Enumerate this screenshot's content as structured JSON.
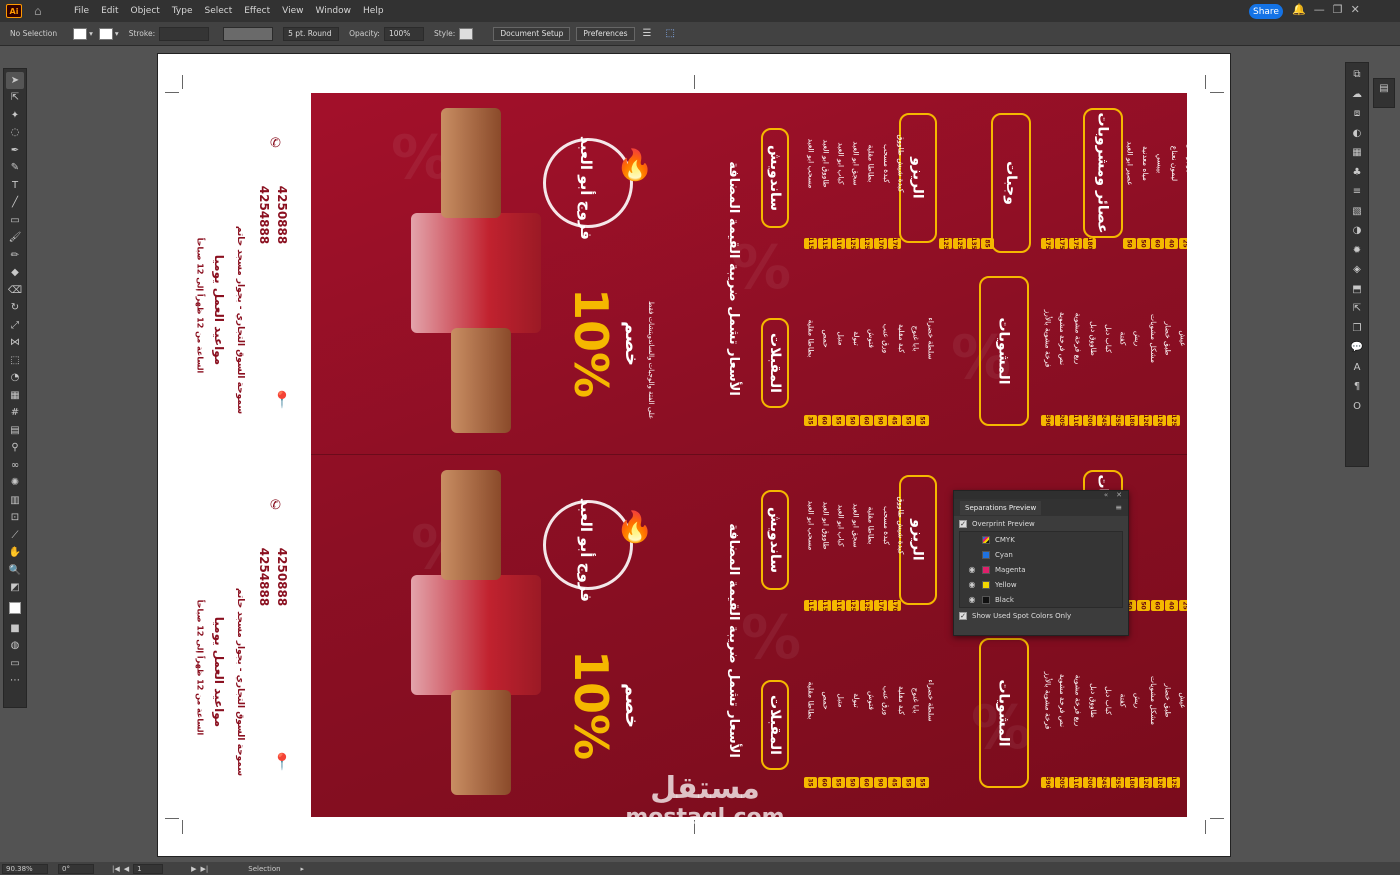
{
  "app": {
    "logo": "Ai"
  },
  "menubar": {
    "items": [
      "File",
      "Edit",
      "Object",
      "Type",
      "Select",
      "Effect",
      "View",
      "Window",
      "Help"
    ],
    "share_label": "Share"
  },
  "control_bar": {
    "selection_label": "No Selection",
    "stroke_label": "Stroke:",
    "brush_value": "5 pt. Round",
    "opacity_label": "Opacity:",
    "opacity_value": "100%",
    "style_label": "Style:",
    "document_setup_label": "Document Setup",
    "preferences_label": "Preferences"
  },
  "separations_panel": {
    "title": "Separations Preview",
    "overprint_label": "Overprint Preview",
    "inks": [
      {
        "name": "CMYK",
        "color": "#ffffff"
      },
      {
        "name": "Cyan",
        "color": "#1f72e0"
      },
      {
        "name": "Magenta",
        "color": "#e0206b"
      },
      {
        "name": "Yellow",
        "color": "#f2d600"
      },
      {
        "name": "Black",
        "color": "#111111"
      }
    ],
    "spot_label": "Show Used Spot Colors Only"
  },
  "status_bar": {
    "zoom": "90.38%",
    "rotation": "0°",
    "artboard": "1",
    "tool": "Selection"
  },
  "flyer": {
    "discount": "10%",
    "discount_word": "خصم",
    "discount_note": "على الفتة والوجبات والساندويتشات فقط",
    "brand": "فروج أبو العبد",
    "tax_note": "الأسعار تشمل ضريبة القيمة المضافة",
    "phone1": "4250888",
    "phone2": "4254888",
    "address": "سموحة السوق التجاري - بجوار مسجد حاتم",
    "hours_title": "مواعيد العمل يوميا",
    "hours": "الساعة من 12 ظهراً إلى 12 صباحاً",
    "categories": [
      "ساندويش",
      "المقبلات",
      "الريزو",
      "المشويات",
      "وجبات",
      "عصائر ومشروبات"
    ],
    "sandwiches": [
      "مسحب ابو العبد",
      "طاووق ابو العبد",
      "كباب ابو العبد",
      "سجق ابو العبد",
      "بطاطا مقلية",
      "كبدة مسحب",
      "كبدة شيش طاووق"
    ],
    "sandwich_prices": [
      "115",
      "115",
      "110",
      "125",
      "125",
      "170",
      "170"
    ],
    "appetizers": [
      "بطاطا مقلية",
      "حمص",
      "متبل",
      "تبولة",
      "فتوش",
      "ورق عنب",
      "كبة مقلية",
      "بابا غنوج",
      "سلطة خضراء"
    ],
    "appetizer_prices": [
      "35",
      "60",
      "55",
      "50",
      "60",
      "90",
      "45",
      "55",
      "55"
    ],
    "rizo_prices": [
      "125",
      "125",
      "135",
      "85"
    ],
    "grills": [
      "فرخة مشوية بالأرز",
      "نص فرخة مشوية",
      "ربع فرخة مشوية",
      "طاووق دبل",
      "كباب دبل",
      "كفتة",
      "ريش",
      "مشكل مشويات",
      "طبق خضار",
      "عيش"
    ],
    "grill_prices": [
      "390",
      "205",
      "110",
      "200",
      "245",
      "255",
      "180",
      "120",
      "120",
      "125"
    ],
    "meals_prices": [
      "175",
      "175",
      "175",
      "180"
    ],
    "drinks": [
      "عصير ابو العبد",
      "مياه معدنية",
      "بيبسي",
      "ليمون نعناع",
      "عصير برتقال",
      "عصير مانجو"
    ],
    "drink_prices": [
      "50",
      "50",
      "60",
      "40",
      "25",
      "15"
    ]
  },
  "watermark": {
    "ar": "مستقل",
    "en": "mostaql.com"
  }
}
